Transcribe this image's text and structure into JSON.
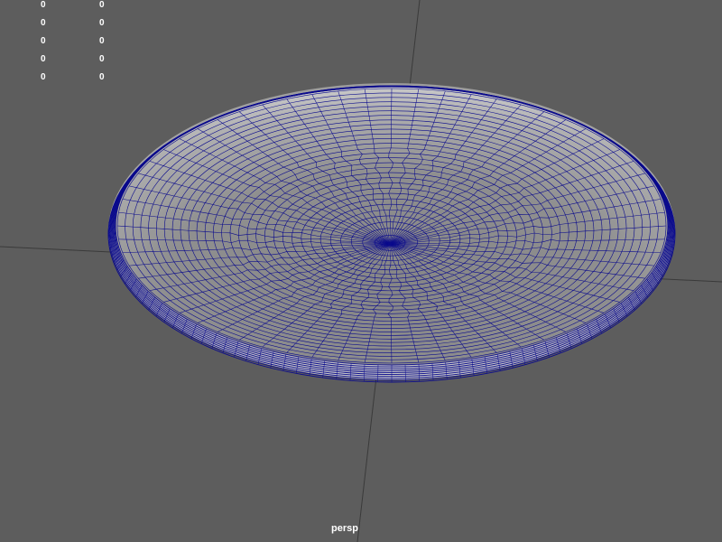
{
  "viewport": {
    "camera_name": "persp",
    "background_color": "#5d5d5d",
    "grid_line_color": "#3a3a3a",
    "wireframe_color": "#0a0a8c",
    "surface_color": "#8e8e8e"
  },
  "hud": {
    "rows": [
      {
        "value_1": "0",
        "value_2": "0"
      },
      {
        "value_1": "0",
        "value_2": "0"
      },
      {
        "value_1": "0",
        "value_2": "0"
      },
      {
        "value_1": "0",
        "value_2": "0"
      },
      {
        "value_1": "0",
        "value_2": "0"
      }
    ]
  },
  "model": {
    "object_type": "shallow bowl wireframe",
    "radial_segments": 64,
    "ring_count": 30
  }
}
